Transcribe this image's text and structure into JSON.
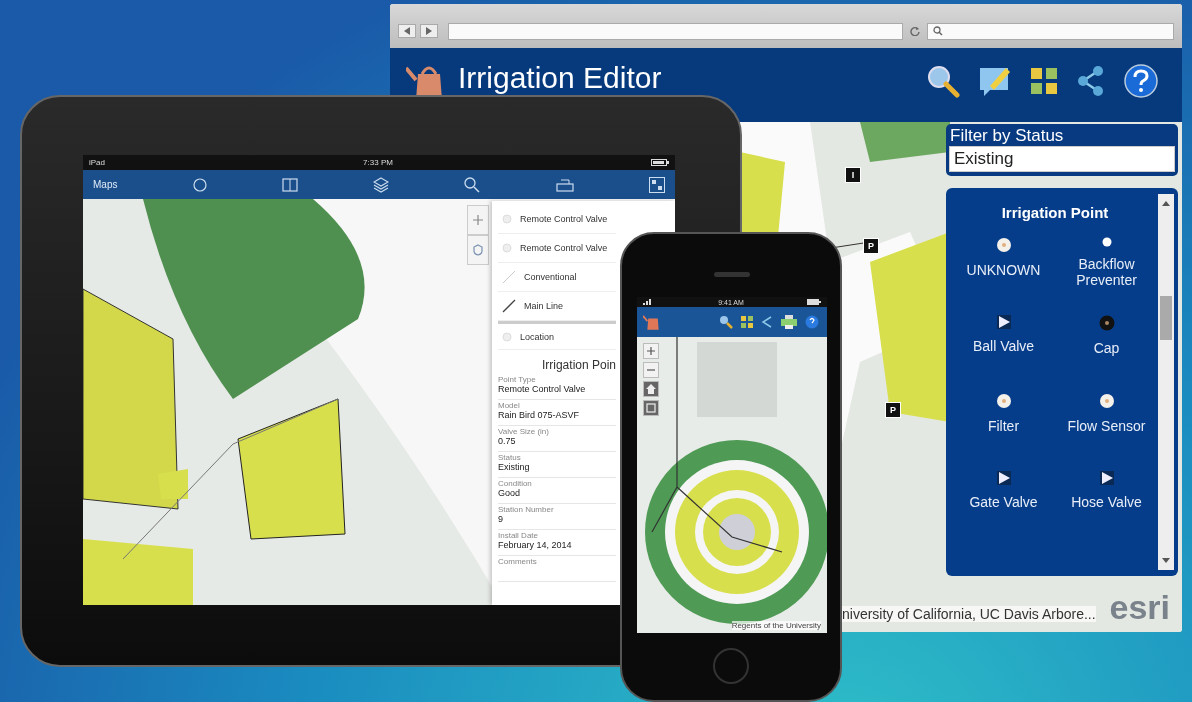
{
  "browser": {
    "app_title": "Irrigation Editor",
    "markers": [
      {
        "label": "I"
      },
      {
        "label": "P"
      },
      {
        "label": "P"
      }
    ],
    "filter": {
      "label": "Filter by Status",
      "value": "Existing"
    },
    "legend": {
      "title": "Irrigation Point",
      "items": [
        {
          "label": "UNKNOWN",
          "kind": "circle"
        },
        {
          "label": "Backflow Preventer",
          "kind": "dot"
        },
        {
          "label": "Ball Valve",
          "kind": "triangle"
        },
        {
          "label": "Cap",
          "kind": "dark"
        },
        {
          "label": "Filter",
          "kind": "circle"
        },
        {
          "label": "Flow Sensor",
          "kind": "circle"
        },
        {
          "label": "Gate Valve",
          "kind": "triangle"
        },
        {
          "label": "Hose Valve",
          "kind": "triangle"
        }
      ]
    },
    "attribution": "niversity of California, UC Davis Arbore...",
    "logo": "esri"
  },
  "tablet": {
    "carrier": "iPad",
    "time": "7:33 PM",
    "toolbar_title": "Maps",
    "layers": [
      {
        "title": "Remote Control Valve",
        "kind": "point"
      },
      {
        "title": "Remote Control Valve",
        "kind": "point"
      },
      {
        "title": "Conventional",
        "kind": "faint-line"
      },
      {
        "title": "Main Line",
        "kind": "line"
      }
    ],
    "location_label": "Location",
    "detail_title": "Irrigation Poin",
    "fields": [
      {
        "label": "Point Type",
        "value": "Remote Control Valve"
      },
      {
        "label": "Model",
        "value": "Rain Bird 075-ASVF"
      },
      {
        "label": "Valve Size (in)",
        "value": "0.75"
      },
      {
        "label": "Status",
        "value": "Existing"
      },
      {
        "label": "Condition",
        "value": "Good"
      },
      {
        "label": "Station Number",
        "value": "9"
      },
      {
        "label": "Install Date",
        "value": "February 14, 2014"
      },
      {
        "label": "Comments"
      }
    ]
  },
  "phone": {
    "time": "9:41 AM",
    "attribution": "Regents of the University"
  }
}
